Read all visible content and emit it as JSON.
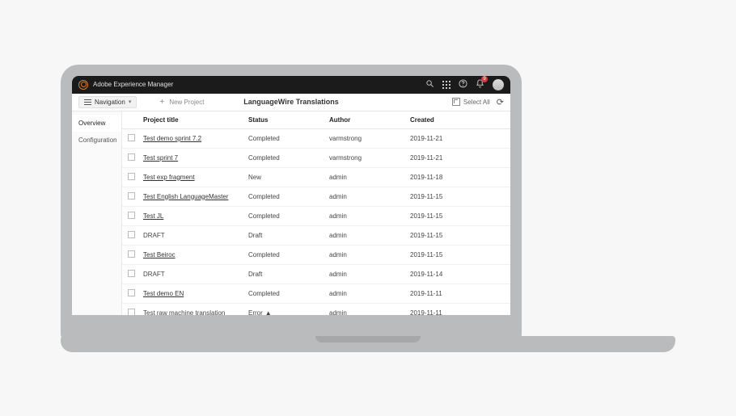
{
  "topbar": {
    "app_title": "Adobe Experience Manager",
    "notification_count": "9"
  },
  "subheader": {
    "navigation_label": "Navigation",
    "new_project_label": "New Project",
    "page_title": "LanguageWire Translations",
    "select_all_label": "Select All"
  },
  "sidebar": {
    "items": [
      {
        "label": "Overview",
        "active": true
      },
      {
        "label": "Configuration",
        "active": false
      }
    ]
  },
  "table": {
    "headers": {
      "title": "Project title",
      "status": "Status",
      "author": "Author",
      "created": "Created"
    },
    "rows": [
      {
        "title": "Test demo sprint 7.2",
        "link": true,
        "status": "Completed",
        "author": "varmstrong",
        "created": "2019-11-21"
      },
      {
        "title": "Test sprint 7",
        "link": true,
        "status": "Completed",
        "author": "varmstrong",
        "created": "2019-11-21"
      },
      {
        "title": "Test exp fragment",
        "link": true,
        "status": "New",
        "author": "admin",
        "created": "2019-11-18"
      },
      {
        "title": "Test English LanguageMaster",
        "link": true,
        "status": "Completed",
        "author": "admin",
        "created": "2019-11-15"
      },
      {
        "title": "Test JL",
        "link": true,
        "status": "Completed",
        "author": "admin",
        "created": "2019-11-15"
      },
      {
        "title": "DRAFT",
        "link": false,
        "status": "Draft",
        "author": "admin",
        "created": "2019-11-15"
      },
      {
        "title": "Test Beiroc",
        "link": true,
        "status": "Completed",
        "author": "admin",
        "created": "2019-11-15"
      },
      {
        "title": "DRAFT",
        "link": false,
        "status": "Draft",
        "author": "admin",
        "created": "2019-11-14"
      },
      {
        "title": "Test demo EN",
        "link": true,
        "status": "Completed",
        "author": "admin",
        "created": "2019-11-11"
      },
      {
        "title": "Test raw machine translation",
        "link": false,
        "status": "Error",
        "error": true,
        "author": "admin",
        "created": "2019-11-11"
      }
    ]
  }
}
